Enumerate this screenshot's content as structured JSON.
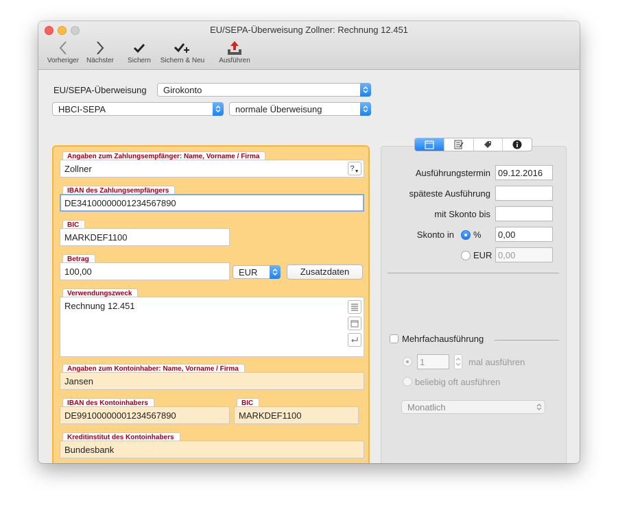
{
  "window": {
    "title": "EU/SEPA-Überweisung Zollner: Rechnung 12.451"
  },
  "toolbar": {
    "prev": "Vorheriger",
    "next": "Nächster",
    "save": "Sichern",
    "save_new": "Sichern & Neu",
    "execute": "Ausführen"
  },
  "form": {
    "type_label": "EU/SEPA-Überweisung",
    "account": "Girokonto",
    "method": "HBCI-SEPA",
    "transfer_type": "normale Überweisung"
  },
  "payee": {
    "name_label": "Angaben zum Zahlungsempfänger: Name, Vorname / Firma",
    "name": "Zollner",
    "name_button": "?",
    "iban_label": "IBAN des Zahlungsempfängers",
    "iban": "DE34100000001234567890",
    "bic_label": "BIC",
    "bic": "MARKDEF1100",
    "amount_label": "Betrag",
    "amount": "100,00",
    "currency": "EUR",
    "extra_button": "Zusatzdaten",
    "purpose_label": "Verwendungszweck",
    "purpose": "Rechnung 12.451"
  },
  "holder": {
    "name_label": "Angaben zum Kontoinhaber: Name, Vorname / Firma",
    "name": "Jansen",
    "iban_label": "IBAN des Kontoinhabers",
    "iban": "DE99100000001234567890",
    "bic_label": "BIC",
    "bic": "MARKDEF1100",
    "bank_label": "Kreditinstitut des Kontoinhabers",
    "bank": "Bundesbank"
  },
  "schedule": {
    "exec_date_label": "Ausführungstermin",
    "exec_date": "09.12.2016",
    "latest_label": "späteste Ausführung",
    "latest": "",
    "skonto_until_label": "mit Skonto bis",
    "skonto_until": "",
    "skonto_in_label": "Skonto in",
    "percent_label": "%",
    "percent_value": "0,00",
    "eur_label": "EUR",
    "eur_value": "0,00",
    "multi_label": "Mehrfachausführung",
    "times_value": "1",
    "times_label": "mal ausführen",
    "any_label": "beliebig oft ausführen",
    "interval": "Monatlich"
  }
}
